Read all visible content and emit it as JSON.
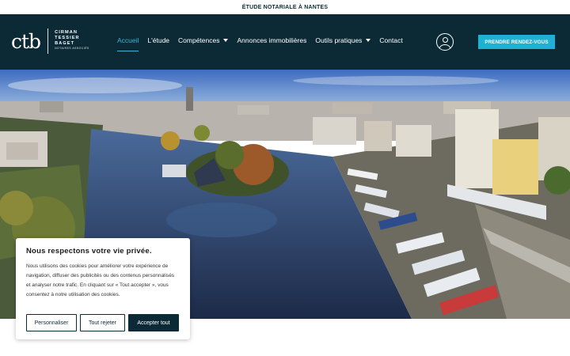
{
  "topbar": {
    "text": "ÉTUDE NOTARIALE À NANTES"
  },
  "logo": {
    "mark": "ctb",
    "name_1": "CIRMAN",
    "name_2": "TESSIER",
    "name_3": "BAGET",
    "subtitle": "NOTAIRES ASSOCIÉS"
  },
  "nav": {
    "items": [
      {
        "label": "Accueil",
        "active": true
      },
      {
        "label": "L'étude"
      },
      {
        "label": "Compétences",
        "dropdown": true
      },
      {
        "label": "Annonces immobilières"
      },
      {
        "label": "Outils pratiques",
        "dropdown": true
      },
      {
        "label": "Contact"
      }
    ]
  },
  "header": {
    "account_icon": "user-circle-icon",
    "cta_label": "PRENDRE RENDEZ-VOUS"
  },
  "hero": {
    "image": "aerial view of a canal with moored boats, trees and city buildings"
  },
  "cookie": {
    "title": "Nous respectons votre vie privée.",
    "body": "Nous utilisons des cookies pour améliorer votre expérience de navigation, diffuser des publicités ou des contenus personnalisés et analyser notre trafic. En cliquant sur « Tout accepter », vous consentez à notre utilisation des cookies.",
    "customize_label": "Personnaliser",
    "reject_label": "Tout rejeter",
    "accept_label": "Accepter tout"
  },
  "colors": {
    "header_bg": "#0b2a36",
    "accent": "#1fb0d5",
    "active_link": "#3fb3d3"
  }
}
